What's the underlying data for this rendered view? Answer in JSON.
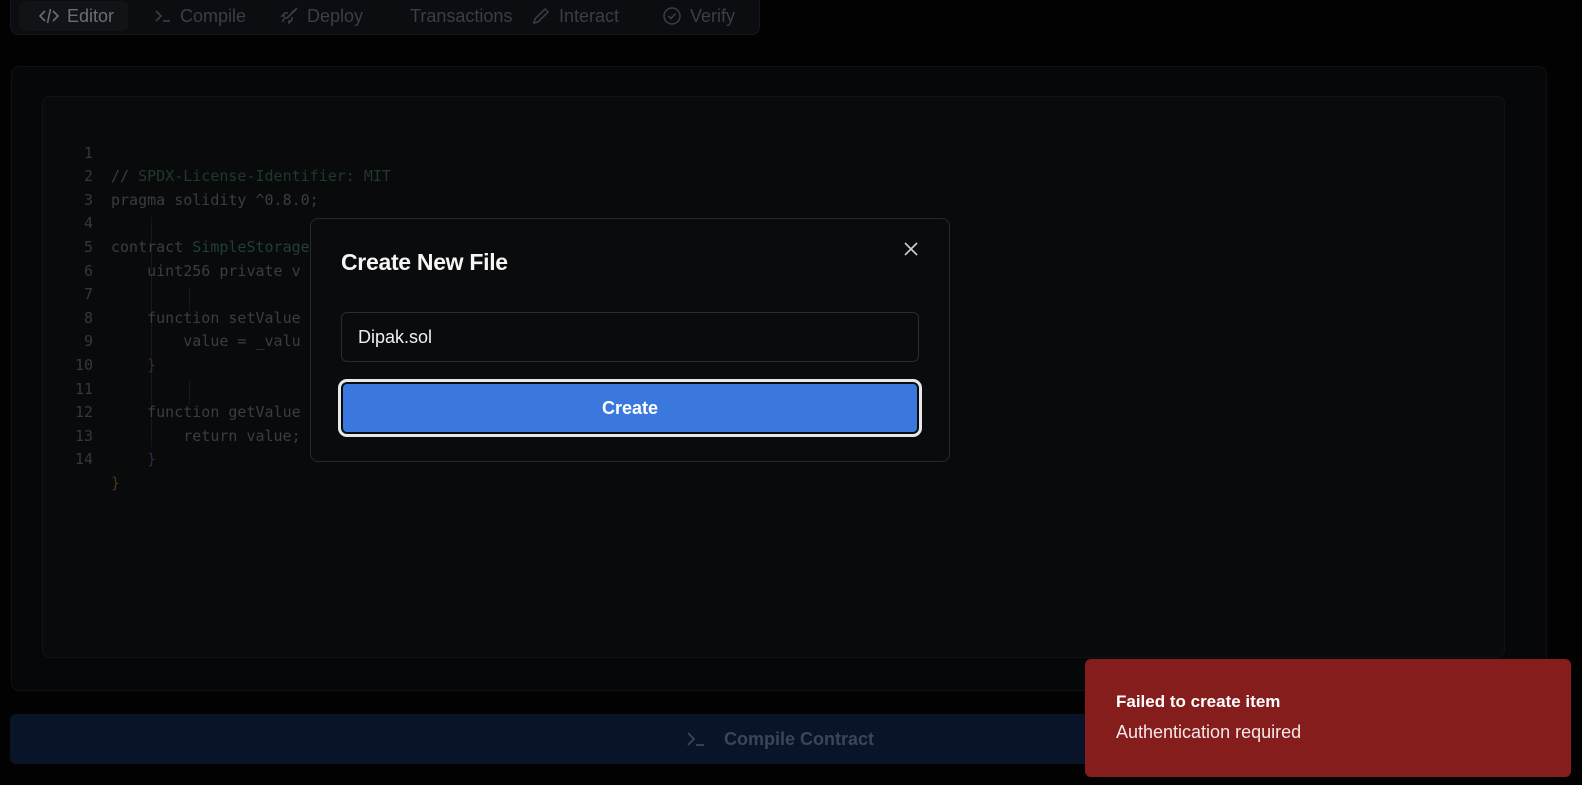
{
  "tabs": [
    {
      "label": "Editor",
      "icon": "code-icon",
      "active": true
    },
    {
      "label": "Compile",
      "icon": "terminal-icon",
      "active": false
    },
    {
      "label": "Deploy",
      "icon": "rocket-icon",
      "active": false
    },
    {
      "label": "Transactions",
      "icon": "",
      "active": false
    },
    {
      "label": "Interact",
      "icon": "pencil-icon",
      "active": false
    },
    {
      "label": "Verify",
      "icon": "check-circle-icon",
      "active": false
    }
  ],
  "editor": {
    "line_numbers": [
      "1",
      "2",
      "3",
      "4",
      "5",
      "6",
      "7",
      "8",
      "9",
      "10",
      "11",
      "12",
      "13",
      "14"
    ],
    "line1": {
      "a": "// ",
      "b": "SPDX-License-Identifier: MIT"
    },
    "line2": "pragma solidity ^0.8.0;",
    "line4": {
      "a": "contract ",
      "b": "SimpleStorage",
      "c": " {"
    },
    "line5": "    uint256 private v",
    "line7": "    function setValue",
    "line8": "        value = _valu",
    "line9": "    }",
    "line11": "    function getValue",
    "line12": "        return value;",
    "line13": "    }",
    "line14": "}"
  },
  "compile_button": {
    "label": "Compile Contract",
    "icon": "terminal-icon"
  },
  "modal": {
    "title": "Create New File",
    "input_value": "Dipak.sol",
    "create_label": "Create",
    "close_icon": "close-icon"
  },
  "toast": {
    "title": "Failed to create item",
    "description": "Authentication required",
    "color": "#861d1d"
  },
  "colors": {
    "accent": "#3b78de",
    "background": "#020203"
  }
}
